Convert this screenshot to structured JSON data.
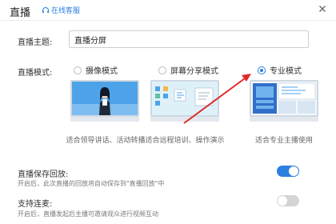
{
  "header": {
    "title": "直播",
    "service_label": "在线客服"
  },
  "topic": {
    "label": "直播主题:",
    "value": "直播分屏"
  },
  "mode": {
    "label": "直播模式:",
    "options": [
      {
        "label": "摄像模式",
        "caption": "适合领导讲话、活动转播",
        "selected": false
      },
      {
        "label": "屏幕分享模式",
        "caption": "适合远程培训、操作演示",
        "selected": false
      },
      {
        "label": "专业模式",
        "caption": "适合专业主播使用",
        "selected": true
      }
    ]
  },
  "options": [
    {
      "title": "直播保存回放:",
      "desc": "开启后，此次直播的回放将自动保存到\"直播回放\"中",
      "enabled": true
    },
    {
      "title": "支持连麦:",
      "desc": "开启后，直播发起后主播可邀请观众进行视频互动",
      "enabled": false
    }
  ],
  "colors": {
    "accent": "#2a7fe0",
    "annotation_arrow": "#e02b2b",
    "toggle_off": "#d4d4d4"
  }
}
